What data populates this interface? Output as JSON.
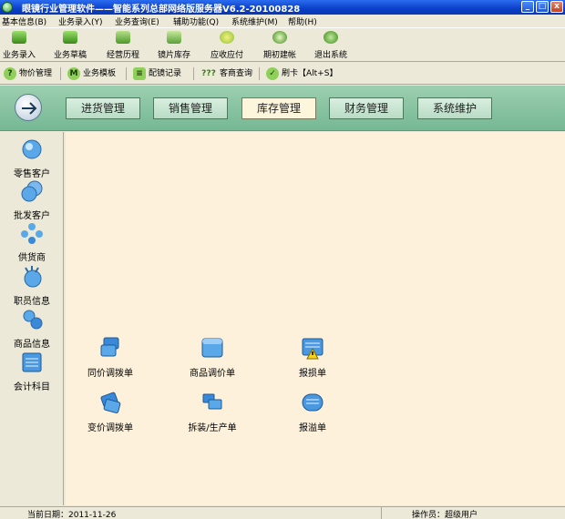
{
  "window": {
    "title": "眼镜行业管理软件——智能系列总部网络版服务器V6.2-20100828",
    "minimize": "_",
    "maximize": "□",
    "close": "x"
  },
  "menu": [
    {
      "label": "基本信息(B)"
    },
    {
      "label": "业务录入(Y)"
    },
    {
      "label": "业务查询(E)"
    },
    {
      "label": "辅助功能(Q)"
    },
    {
      "label": "系统维护(M)"
    },
    {
      "label": "帮助(H)"
    }
  ],
  "toolbar1": [
    {
      "label": "业务录入",
      "icon": "list-icon"
    },
    {
      "label": "业务草稿",
      "icon": "draft-icon"
    },
    {
      "label": "经营历程",
      "icon": "history-icon"
    },
    {
      "label": "镜片库存",
      "icon": "lens-stock-icon"
    },
    {
      "label": "应收应付",
      "icon": "receivable-icon"
    },
    {
      "label": "期初建帐",
      "icon": "setup-icon"
    },
    {
      "label": "退出系统",
      "icon": "exit-icon"
    }
  ],
  "toolbar2": [
    {
      "label": "物价管理",
      "icon": "question-icon",
      "glyph": "?"
    },
    {
      "label": "业务模板",
      "icon": "m-icon",
      "glyph": "M"
    },
    {
      "label": "配镜记录",
      "icon": "record-icon",
      "glyph": "≡"
    },
    {
      "label": "客商查询",
      "icon": "query-icon",
      "glyph": "???"
    },
    {
      "label": "刷卡【Alt+S】",
      "icon": "card-icon",
      "glyph": "✓"
    }
  ],
  "nav": {
    "tabs": [
      {
        "label": "进货管理"
      },
      {
        "label": "销售管理"
      },
      {
        "label": "库存管理",
        "active": true
      },
      {
        "label": "财务管理"
      },
      {
        "label": "系统维护"
      }
    ]
  },
  "sidebar": [
    {
      "label": "零售客户",
      "icon": "retail-customer-icon"
    },
    {
      "label": "批发客户",
      "icon": "wholesale-customer-icon"
    },
    {
      "label": "供货商",
      "icon": "supplier-icon"
    },
    {
      "label": "职员信息",
      "icon": "staff-icon"
    },
    {
      "label": "商品信息",
      "icon": "product-icon"
    },
    {
      "label": "会计科目",
      "icon": "account-icon"
    }
  ],
  "content": [
    {
      "label": "同价调拨单",
      "icon": "transfer-icon"
    },
    {
      "label": "商品调价单",
      "icon": "price-adjust-icon"
    },
    {
      "label": "报损单",
      "icon": "loss-report-icon"
    },
    {
      "label": "变价调拨单",
      "icon": "price-change-transfer-icon"
    },
    {
      "label": "拆装/生产单",
      "icon": "assembly-icon"
    },
    {
      "label": "报溢单",
      "icon": "overflow-report-icon"
    }
  ],
  "status": {
    "date_label": "当前日期：2011-11-26",
    "operator_label": "操作员：超级用户"
  },
  "colors": {
    "title_bar": "#0a3fc8",
    "nav_band": "#87c3a2",
    "content_bg": "#fdf1db",
    "active_tab": "#fdf5dc"
  }
}
